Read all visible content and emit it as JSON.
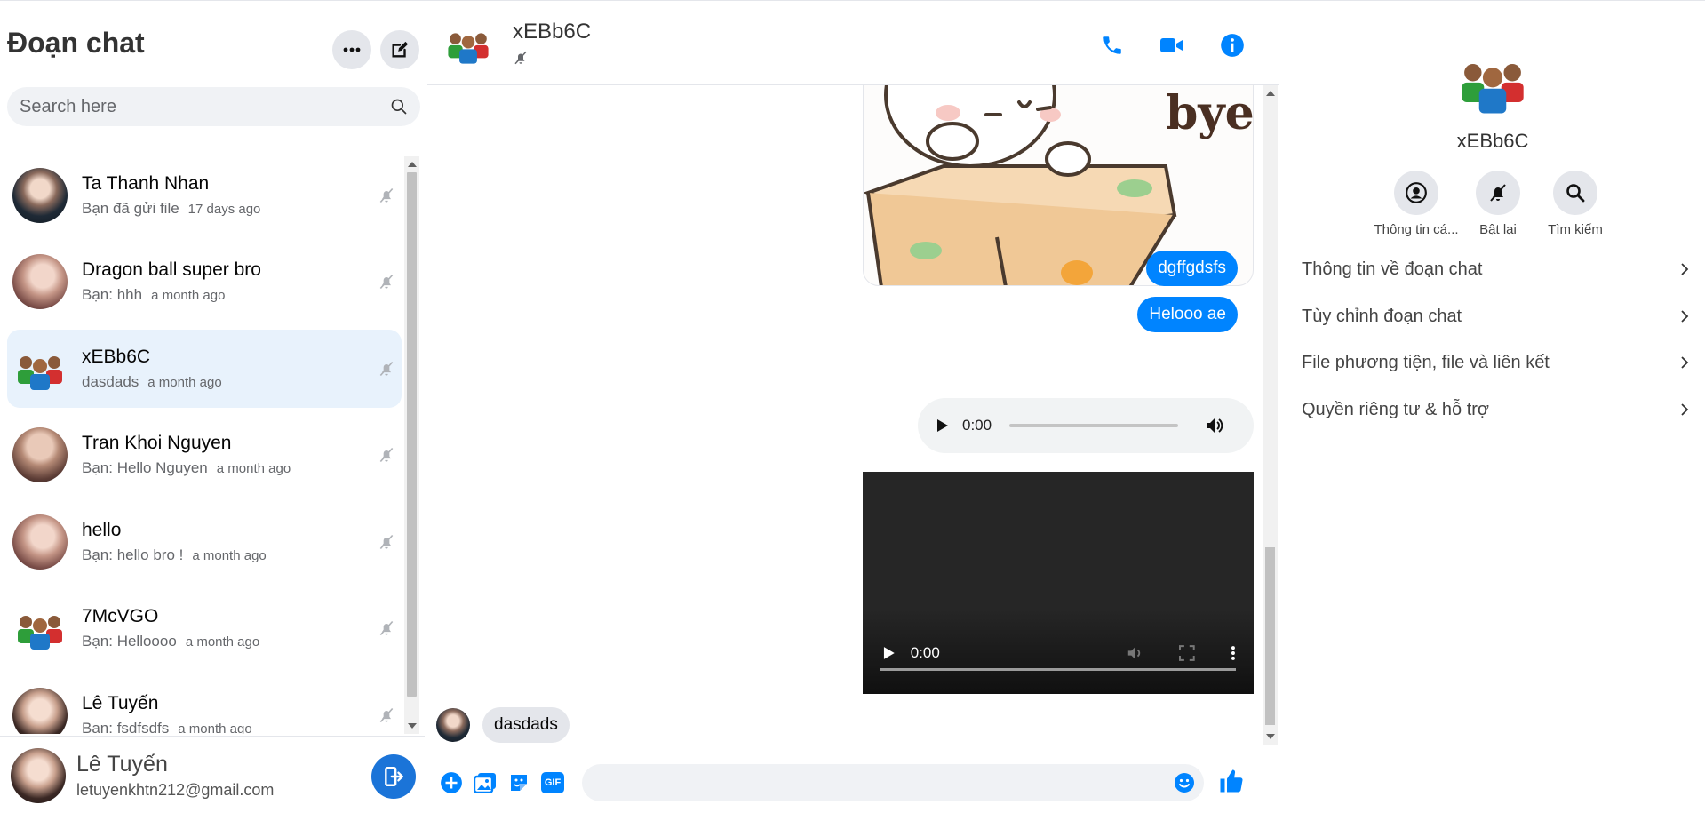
{
  "sidebar": {
    "title": "Đoạn chat",
    "more_icon": "more-horizontal-icon",
    "compose_icon": "compose-icon",
    "search_placeholder": "Search here",
    "conversations": [
      {
        "name": "Ta Thanh Nhan",
        "last": "Bạn đã gửi file",
        "time": "17 days ago",
        "avatar": "photo-dark"
      },
      {
        "name": "Dragon ball super bro",
        "last": "Bạn: hhh",
        "time": "a month ago",
        "avatar": "photo"
      },
      {
        "name": "xEBb6C",
        "last": "dasdads",
        "time": "a month ago",
        "avatar": "group-icon",
        "active": true
      },
      {
        "name": "Tran Khoi Nguyen",
        "last": "Bạn: Hello Nguyen",
        "time": "a month ago",
        "avatar": "photo"
      },
      {
        "name": "hello",
        "last": "Bạn: hello bro !",
        "time": "a month ago",
        "avatar": "photo"
      },
      {
        "name": "7McVGO",
        "last": "Bạn: Helloooo",
        "time": "a month ago",
        "avatar": "group-icon"
      },
      {
        "name": "Lê Tuyến",
        "last": "Bạn: fsdfsdfs",
        "time": "a month ago",
        "avatar": "photo-lady"
      }
    ],
    "user": {
      "name": "Lê Tuyến",
      "email": "letuyenkhtn212@gmail.com"
    }
  },
  "chat": {
    "title": "xEBb6C",
    "status_icon": "bell-off-icon",
    "header_icons": [
      "phone-icon",
      "video-camera-icon",
      "info-icon"
    ],
    "sticker_text": "bye",
    "messages_out": [
      "dgffgdsfs",
      "Helooo ae"
    ],
    "audio_time": "0:00",
    "video_time": "0:00",
    "incoming_message": "dasdads",
    "composer_icons": [
      "plus-icon",
      "image-icon",
      "sticker-icon",
      "gif-icon"
    ],
    "gif_label": "GIF",
    "input_value": "",
    "like_icon": "thumbs-up-icon",
    "colors": {
      "accent": "#0084ff",
      "active_row": "#e8f2fc"
    }
  },
  "info": {
    "name": "xEBb6C",
    "actions": [
      {
        "label": "Thông tin cá...",
        "icon": "profile-icon"
      },
      {
        "label": "Bật lại",
        "icon": "bell-off-icon"
      },
      {
        "label": "Tìm kiếm",
        "icon": "search-icon"
      }
    ],
    "menu": [
      "Thông tin về đoạn chat",
      "Tùy chỉnh đoạn chat",
      "File phương tiện, file và liên kết",
      "Quyền riêng tư & hỗ trợ"
    ]
  }
}
